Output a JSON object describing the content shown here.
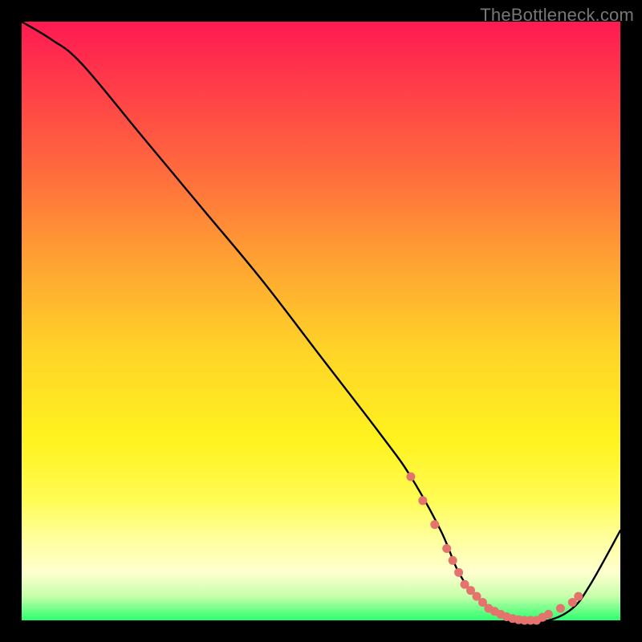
{
  "watermark": "TheBottleneck.com",
  "colors": {
    "background": "#000000",
    "curve": "#000000",
    "dot": "#e4736e",
    "gradient_stops": [
      "#ff1a52",
      "#ff3a4a",
      "#ff6b3d",
      "#ffa232",
      "#ffd428",
      "#fff31f",
      "#fffc55",
      "#ffff9a",
      "#ffffcf",
      "#c6ffaa",
      "#2bff6e"
    ]
  },
  "chart_data": {
    "type": "line",
    "title": "",
    "xlabel": "",
    "ylabel": "",
    "xlim": [
      0,
      100
    ],
    "ylim": [
      0,
      100
    ],
    "series": [
      {
        "name": "bottleneck-curve",
        "x": [
          0,
          5,
          10,
          20,
          30,
          40,
          50,
          60,
          65,
          70,
          73,
          76,
          80,
          84,
          88,
          92,
          95,
          100
        ],
        "values": [
          100,
          97,
          93,
          81,
          69,
          57,
          44,
          31,
          24,
          15,
          8,
          4,
          1,
          0,
          0,
          2,
          6,
          15
        ]
      }
    ],
    "markers": {
      "name": "highlighted-range",
      "x": [
        65,
        67,
        69,
        71,
        72,
        73,
        74,
        75,
        76,
        77,
        78,
        79,
        80,
        81,
        82,
        83,
        84,
        85,
        86,
        87,
        88,
        90,
        92,
        93
      ],
      "values": [
        24,
        20,
        16,
        12,
        10,
        8,
        6,
        5,
        4,
        3,
        2,
        1.5,
        1,
        0.6,
        0.3,
        0.1,
        0,
        0,
        0,
        0.5,
        1,
        2,
        3,
        4
      ]
    }
  }
}
